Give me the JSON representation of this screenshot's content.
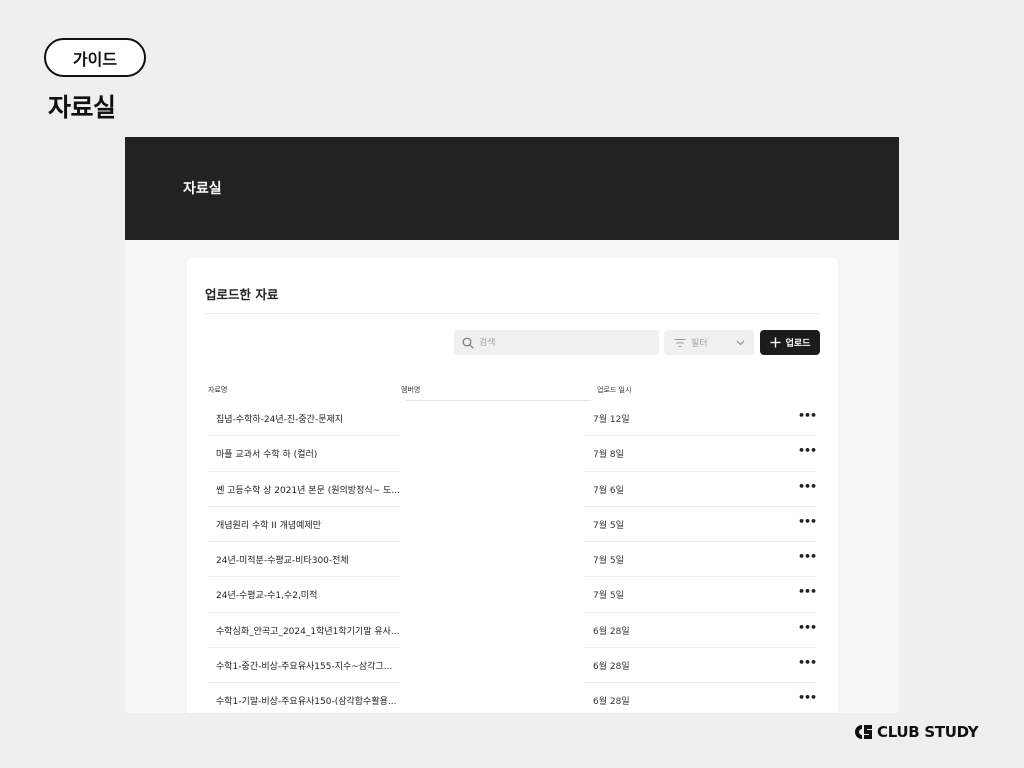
{
  "guide_label": "가이드",
  "page_heading": "자료실",
  "app": {
    "header_title": "자료실",
    "card_title": "업로드한 자료",
    "search": {
      "placeholder": "검색"
    },
    "filter": {
      "label": "필터"
    },
    "upload_button": {
      "label": "업로드"
    },
    "table": {
      "headers": {
        "name": "자료명",
        "member": "멤버명",
        "date": "업로드 일시"
      },
      "rows": [
        {
          "name": "집념-수학하-24년-진-중간-문제지",
          "date": "7월 12일"
        },
        {
          "name": "마플 교과서 수학 하 (컬러)",
          "date": "7월 8일"
        },
        {
          "name": "쎈 고등수학 상 2021년 본문 (원의방정식~ 도...",
          "date": "7월 6일"
        },
        {
          "name": "개념원리 수학 II 개념예제만",
          "date": "7월 5일"
        },
        {
          "name": "24년-미적분-수평교-비타300-전체",
          "date": "7월 5일"
        },
        {
          "name": "24년-수평교-수1,수2,미적",
          "date": "7월 5일"
        },
        {
          "name": "수학심화_안곡고_2024_1학년1학기기말 유사...",
          "date": "6월 28일"
        },
        {
          "name": "수학1-중간-비상-주요유사155-지수~삼각그...",
          "date": "6월 28일"
        },
        {
          "name": "수학1-기말-비상-주요유사150-(삼각함수활용...",
          "date": "6월 28일"
        }
      ]
    }
  },
  "brand": {
    "name": "CLUB STUDY"
  },
  "icons": {
    "search": "search-icon",
    "filter": "filter-icon",
    "chevron": "chevron-down-icon",
    "plus": "plus-icon",
    "more": "more-horizontal-icon",
    "logo": "club-study-logo-icon"
  }
}
